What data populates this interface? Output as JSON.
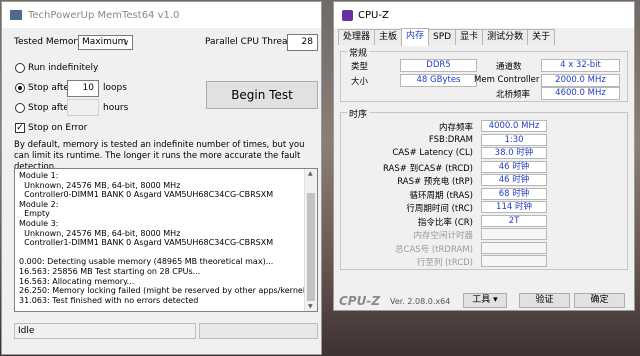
{
  "memtest": {
    "title": "TechPowerUp MemTest64 v1.0",
    "tested_memory_label": "Tested Memory:",
    "tested_memory_value": "Maximum",
    "threads_label": "Parallel CPU Threads:",
    "threads_value": "28",
    "run_indefinitely": "Run indefinitely",
    "stop_after": "Stop after",
    "loops_value": "10",
    "loops_label": "loops",
    "stop_after_hours": "Stop after",
    "hours_label": "hours",
    "begin_test": "Begin Test",
    "stop_on_error": "Stop on Error",
    "description": "By default, memory is tested an indefinite number of times, but you can limit its runtime. The longer it runs the more accurate the fault detection.",
    "log_lines": [
      "Module 1:",
      "  Unknown, 24576 MB, 64-bit, 8000 MHz",
      "  Controller0-DIMM1 BANK 0 Asgard VAM5UH68C34CG-CBRSXM",
      "Module 2:",
      "  Empty",
      "Module 3:",
      "  Unknown, 24576 MB, 64-bit, 8000 MHz",
      "  Controller1-DIMM1 BANK 0 Asgard VAM5UH68C34CG-CBRSXM",
      "",
      "0.000: Detecting usable memory (48965 MB theoretical max)...",
      "16.563: 25856 MB Test starting on 28 CPUs...",
      "16.563: Allocating memory...",
      "26.250: Memory locking failed (might be reserved by other apps/kernel)",
      "31.063: Test finished with no errors detected"
    ],
    "status": "Idle"
  },
  "cpuz": {
    "title": "CPU-Z",
    "tabs": [
      "处理器",
      "主板",
      "内存",
      "SPD",
      "显卡",
      "测试分数",
      "关于"
    ],
    "general_title": "常规",
    "type_label": "类型",
    "type_value": "DDR5",
    "size_label": "大小",
    "size_value": "48 GBytes",
    "channels_label": "通道数",
    "channels_value": "4 x 32-bit",
    "memctrl_label": "Mem Controller",
    "memctrl_value": "2000.0 MHz",
    "nb_label": "北桥频率",
    "nb_value": "4600.0 MHz",
    "timings_title": "时序",
    "timings": [
      {
        "label": "内存频率",
        "value": "4000.0 MHz"
      },
      {
        "label": "FSB:DRAM",
        "value": "1:30"
      },
      {
        "label": "CAS# Latency (CL)",
        "value": "38.0 时钟"
      },
      {
        "label": "RAS# 到CAS# (tRCD)",
        "value": "46 时钟"
      },
      {
        "label": "RAS# 预充电 (tRP)",
        "value": "46 时钟"
      },
      {
        "label": "循环周期 (tRAS)",
        "value": "68 时钟"
      },
      {
        "label": "行周期时间 (tRC)",
        "value": "114 时钟"
      },
      {
        "label": "指令比率 (CR)",
        "value": "2T"
      },
      {
        "label": "内存空闲计时器",
        "value": ""
      },
      {
        "label": "总CAS号 (tRDRAM)",
        "value": ""
      },
      {
        "label": "行至列 (tRCD)",
        "value": ""
      }
    ],
    "brand": "CPU-Z",
    "version": "Ver. 2.08.0.x64",
    "tools": "工具",
    "validate": "验证",
    "ok": "确定"
  }
}
